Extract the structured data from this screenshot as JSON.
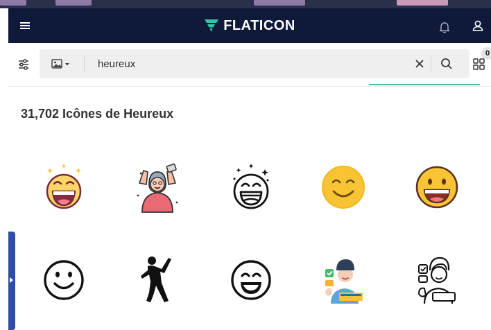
{
  "header": {
    "logo_text": "FLATICON",
    "menu_icon": "hamburger-menu-icon",
    "notification_icon": "bell-icon",
    "user_icon": "user-icon"
  },
  "search": {
    "value": "heureux",
    "placeholder": "",
    "filter_icon": "filter-sliders-icon",
    "type_icon": "image-icon",
    "clear_icon": "close-icon",
    "search_icon": "search-icon",
    "collection_icon": "grid-icon",
    "collection_count": "0"
  },
  "results": {
    "title": "31,702 Icônes de Heureux",
    "icons": [
      {
        "name": "laughing-face-sparkles-icon"
      },
      {
        "name": "celebrating-grandmother-icon"
      },
      {
        "name": "laughing-face-outline-icon"
      },
      {
        "name": "smiling-face-icon"
      },
      {
        "name": "grinning-face-icon"
      },
      {
        "name": "smiley-outline-icon"
      },
      {
        "name": "dancing-silhouette-icon"
      },
      {
        "name": "grinning-face-outline-icon"
      },
      {
        "name": "satisfied-customer-icon"
      },
      {
        "name": "satisfied-customer-outline-icon"
      }
    ]
  },
  "colors": {
    "navbar": "#0f1a3a",
    "logo_accent": "#36c3a7",
    "emoji_yellow": "#f9c433",
    "sidebar_tab": "#2f4ea8"
  }
}
